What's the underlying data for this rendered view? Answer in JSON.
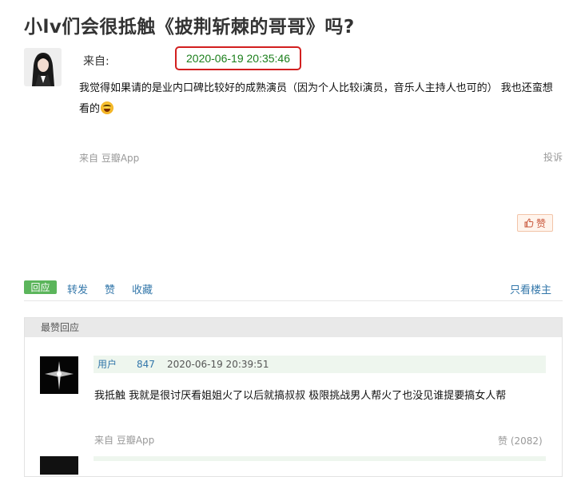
{
  "post": {
    "title": "小lv们会很抵触《披荆斩棘的哥哥》吗?",
    "from_label": "来自:",
    "timestamp": "2020-06-19 20:35:46",
    "body": "我觉得如果请的是业内口碑比较好的成熟演员（因为个人比较i演员，音乐人主持人也可的） 我也还蛮想看的",
    "emoji_icon": "laughing-tears-emoji",
    "source": "来自 豆瓣App",
    "report": "投诉",
    "like_label": "赞"
  },
  "actions": {
    "reply": "回应",
    "forward": "转发",
    "like": "赞",
    "collect": "收藏",
    "only_op": "只看楼主"
  },
  "best_replies": {
    "header": "最赞回应",
    "items": [
      {
        "user": "用户",
        "user_id": "847",
        "time": "2020-06-19 20:39:51",
        "text": "我抵触 我就是很讨厌看姐姐火了以后就搞叔叔 极限挑战男人帮火了也没见谁提要搞女人帮",
        "source": "来自 豆瓣App",
        "likes": "赞 (2082)"
      }
    ]
  },
  "colors": {
    "highlight_border": "#d21f1f",
    "timestamp_green": "#1b7f1b",
    "link_blue": "#3377aa",
    "reply_green": "#5bb55b"
  }
}
